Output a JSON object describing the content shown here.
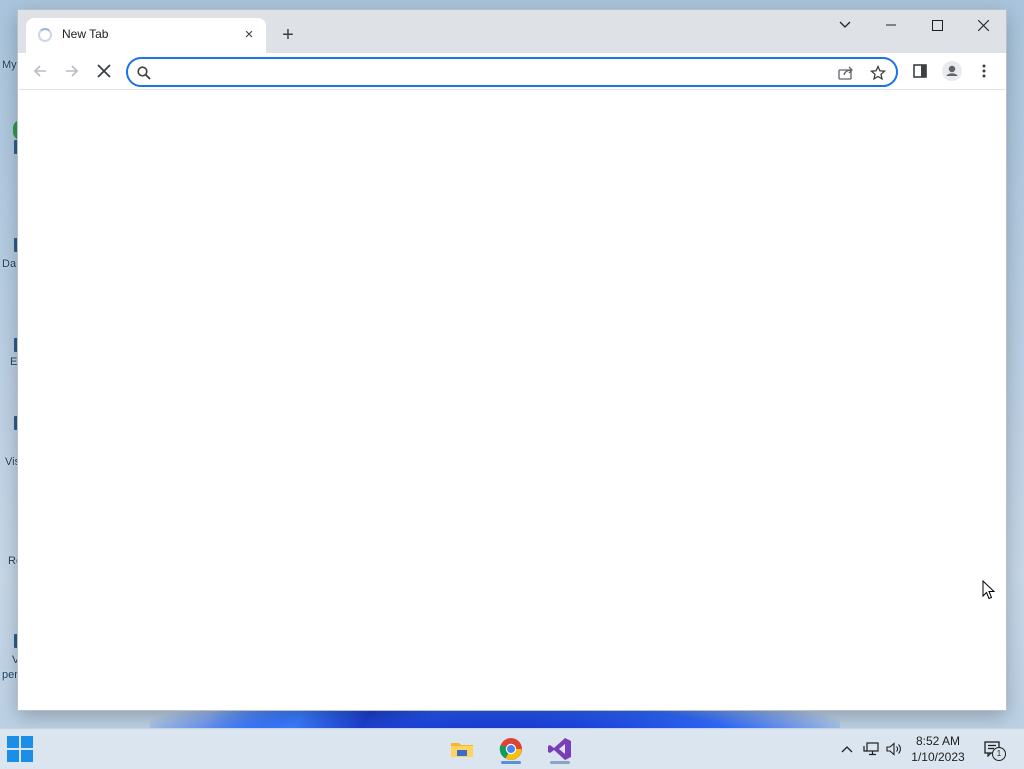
{
  "desktop": {
    "icon_labels": [
      "My",
      "Da",
      "E",
      "Vis",
      "Re",
      "V",
      "per"
    ]
  },
  "browser": {
    "tab": {
      "title": "New Tab",
      "close_label": "×"
    },
    "new_tab_label": "+",
    "omnibox": {
      "value": "",
      "placeholder": ""
    },
    "window_controls": [
      "tab-search",
      "minimize",
      "maximize",
      "close"
    ]
  },
  "taskbar": {
    "apps": [
      "start",
      "file-explorer",
      "chrome",
      "visual-studio"
    ],
    "active_app": "chrome",
    "time": "8:52 AM",
    "date": "1/10/2023",
    "notification_count": "1"
  },
  "colors": {
    "accent": "#1a73e8",
    "titlebar": "#dee1e6",
    "taskbar": "#dbe5ef"
  }
}
